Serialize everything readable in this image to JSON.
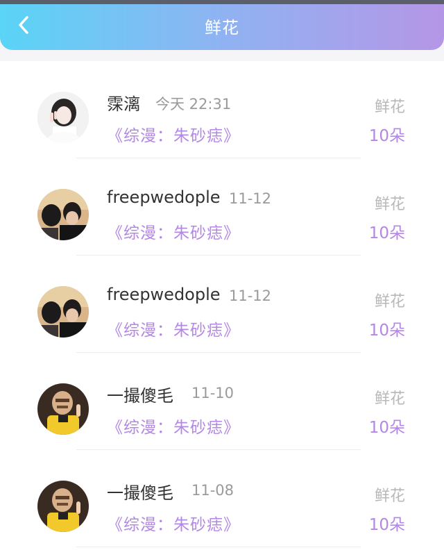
{
  "header": {
    "title": "鲜花",
    "back_icon": "chevron-left-icon",
    "gradient_start": "#5ad4f6",
    "gradient_end": "#b596e6"
  },
  "gift_list": [
    {
      "name": "霂漓",
      "time": "今天 22:31",
      "book": "《综漫：朱砂痣》",
      "gift_label": "鲜花",
      "gift_count": "10朵",
      "avatar_style": "girl-photo"
    },
    {
      "name": "freepwedople",
      "time": "11-12",
      "book": "《综漫：朱砂痣》",
      "gift_label": "鲜花",
      "gift_count": "10朵",
      "avatar_style": "couple-photo"
    },
    {
      "name": "freepwedople",
      "time": "11-12",
      "book": "《综漫：朱砂痣》",
      "gift_label": "鲜花",
      "gift_count": "10朵",
      "avatar_style": "couple-photo"
    },
    {
      "name": "一撮傻毛",
      "time": "11-10",
      "book": "《综漫：朱砂痣》",
      "gift_label": "鲜花",
      "gift_count": "10朵",
      "avatar_style": "masked-figure"
    },
    {
      "name": "一撮傻毛",
      "time": "11-08",
      "book": "《综漫：朱砂痣》",
      "gift_label": "鲜花",
      "gift_count": "10朵",
      "avatar_style": "masked-figure"
    }
  ],
  "colors": {
    "accent_purple": "#b387e6",
    "muted_gray": "#b8b8b8"
  }
}
